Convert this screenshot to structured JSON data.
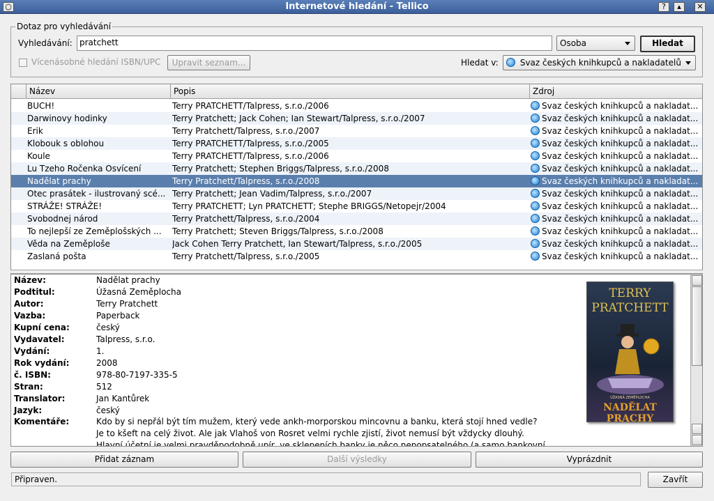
{
  "window": {
    "title": "Internetové hledání - Tellico"
  },
  "query": {
    "group_title": "Dotaz pro vyhledávání",
    "search_label": "Vyhledávání:",
    "search_value": "pratchett",
    "key_selected": "Osoba",
    "search_button": "Hledat",
    "multi_isbn_label": "Vícenásobné hledání ISBN/UPC",
    "edit_list_button": "Upravit seznam...",
    "search_in_label": "Hledat v:",
    "source_selected": "Svaz českých knihkupců a nakladatelů"
  },
  "results": {
    "columns": [
      "Název",
      "Popis",
      "Zdroj"
    ],
    "rows": [
      {
        "title": "BUCH!",
        "desc": "Terry PRATCHETT/Talpress, s.r.o./2006",
        "source": "Svaz českých knihkupců a nakladat..."
      },
      {
        "title": "Darwinovy hodinky",
        "desc": "Terry Pratchett; Jack Cohen; Ian Stewart/Talpress, s.r.o./2007",
        "source": "Svaz českých knihkupců a nakladat..."
      },
      {
        "title": "Erik",
        "desc": "Terry Pratchett/Talpress, s.r.o./2007",
        "source": "Svaz českých knihkupců a nakladat..."
      },
      {
        "title": "Klobouk s oblohou",
        "desc": "Terry PRATCHETT/Talpress, s.r.o./2005",
        "source": "Svaz českých knihkupců a nakladat..."
      },
      {
        "title": "Koule",
        "desc": "Terry PRATCHETT/Talpress, s.r.o./2006",
        "source": "Svaz českých knihkupců a nakladat..."
      },
      {
        "title": "Lu Tzeho Ročenka Osvícení",
        "desc": "Terry Pratchett; Stephen Briggs/Talpress, s.r.o./2008",
        "source": "Svaz českých knihkupců a nakladat..."
      },
      {
        "title": "Nadělat prachy",
        "desc": "Terry Pratchett/Talpress, s.r.o./2008",
        "source": "Svaz českých knihkupců a nakladat..."
      },
      {
        "title": "Otec prasátek - ilustrovaný scé...",
        "desc": "Terry Pratchett; Jean Vadim/Talpress, s.r.o./2007",
        "source": "Svaz českých knihkupců a nakladat..."
      },
      {
        "title": "STRÁŽE! STRÁŽE!",
        "desc": "Terry PRATCHETT; Lyn PRATCHETT; Stephe BRIGGS/Netopejr/2004",
        "source": "Svaz českých knihkupců a nakladat..."
      },
      {
        "title": "Svobodnej národ",
        "desc": "Terry Pratchett/Talpress, s.r.o./2004",
        "source": "Svaz českých knihkupců a nakladat..."
      },
      {
        "title": "To nejlepší ze Zeměplošských ...",
        "desc": "Terry Pratchett; Steven Briggs/Talpress, s.r.o./2008",
        "source": "Svaz českých knihkupců a nakladat..."
      },
      {
        "title": "Věda na Zeměploše",
        "desc": "Jack Cohen Terry Pratchett, Ian Stewart/Talpress, s.r.o./2005",
        "source": "Svaz českých knihkupců a nakladat..."
      },
      {
        "title": "Zaslaná pošta",
        "desc": "Terry Pratchett/Talpress, s.r.o./2005",
        "source": "Svaz českých knihkupců a nakladat..."
      }
    ],
    "selected_index": 6
  },
  "details": {
    "fields": [
      {
        "label": "Název:",
        "value": "Nadělat prachy"
      },
      {
        "label": "Podtitul:",
        "value": "Úžasná Zeměplocha"
      },
      {
        "label": "Autor:",
        "value": "Terry Pratchett"
      },
      {
        "label": "Vazba:",
        "value": "Paperback"
      },
      {
        "label": "Kupní cena:",
        "value": "český"
      },
      {
        "label": "Vydavatel:",
        "value": "Talpress, s.r.o."
      },
      {
        "label": "Vydání:",
        "value": "1."
      },
      {
        "label": "Rok vydání:",
        "value": "2008"
      },
      {
        "label": "č. ISBN:",
        "value": "978-80-7197-335-5"
      },
      {
        "label": "Stran:",
        "value": "512"
      },
      {
        "label": "Translator:",
        "value": "Jan Kantůrek"
      },
      {
        "label": "Jazyk:",
        "value": "český"
      }
    ],
    "comments_label": "Komentáře:",
    "comments": [
      "Kdo by si nepřál být tím mužem, který vede ankh-morporskou mincovnu a banku, která stojí hned vedle?",
      "Je to kšeft na celý život. Ale jak Vlahoš von Rosret velmi rychle zjistí, život nemusí být vždycky dlouhý.",
      "Hlavní účetní je velmi pravděpodobně upír, ve sklepeních banky je něco nepopsatelného (a samo bankovní"
    ],
    "cover": {
      "author": "TERRY",
      "author2": "PRATCHETT",
      "title": "NADĚLAT PRACHY",
      "small": "ÚŽASNÁ ZEMĚPLOCHA"
    }
  },
  "actions": {
    "add": "Přidat záznam",
    "more": "Další výsledky",
    "clear": "Vyprázdnit",
    "close": "Zavřít"
  },
  "status": "Připraven."
}
